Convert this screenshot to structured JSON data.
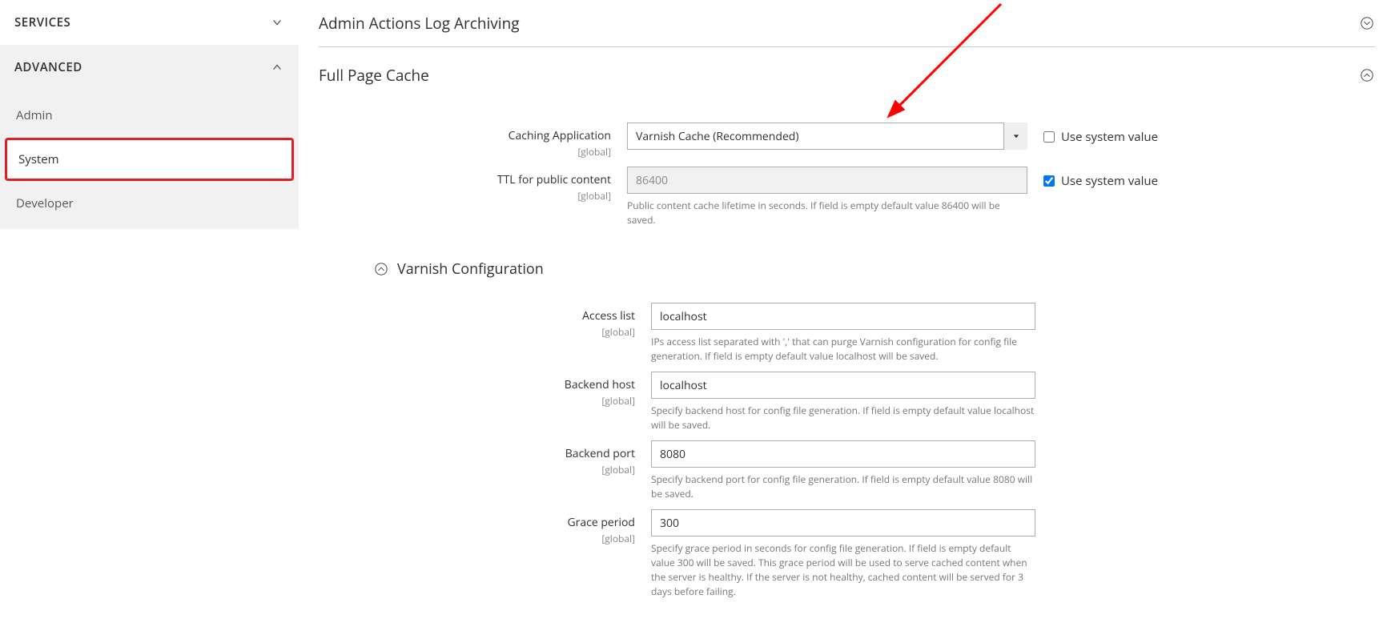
{
  "sidebar": {
    "services_label": "SERVICES",
    "advanced_label": "ADVANCED",
    "items": [
      {
        "label": "Admin"
      },
      {
        "label": "System"
      },
      {
        "label": "Developer"
      }
    ]
  },
  "sections": {
    "archive_title": "Admin Actions Log Archiving",
    "fpc_title": "Full Page Cache"
  },
  "fpc": {
    "caching_app": {
      "label": "Caching Application",
      "scope": "[global]",
      "value": "Varnish Cache (Recommended)",
      "system_label": "Use system value",
      "system_checked": false
    },
    "ttl": {
      "label": "TTL for public content",
      "scope": "[global]",
      "value": "86400",
      "hint": "Public content cache lifetime in seconds. If field is empty default value 86400 will be saved.",
      "system_label": "Use system value",
      "system_checked": true
    }
  },
  "varnish": {
    "title": "Varnish Configuration",
    "access_list": {
      "label": "Access list",
      "scope": "[global]",
      "value": "localhost",
      "hint": "IPs access list separated with ',' that can purge Varnish configuration for config file generation. If field is empty default value localhost will be saved."
    },
    "backend_host": {
      "label": "Backend host",
      "scope": "[global]",
      "value": "localhost",
      "hint": "Specify backend host for config file generation. If field is empty default value localhost will be saved."
    },
    "backend_port": {
      "label": "Backend port",
      "scope": "[global]",
      "value": "8080",
      "hint": "Specify backend port for config file generation. If field is empty default value 8080 will be saved."
    },
    "grace_period": {
      "label": "Grace period",
      "scope": "[global]",
      "value": "300",
      "hint": "Specify grace period in seconds for config file generation. If field is empty default value 300 will be saved. This grace period will be used to serve cached content when the server is healthy. If the server is not healthy, cached content will be served for 3 days before failing."
    }
  }
}
